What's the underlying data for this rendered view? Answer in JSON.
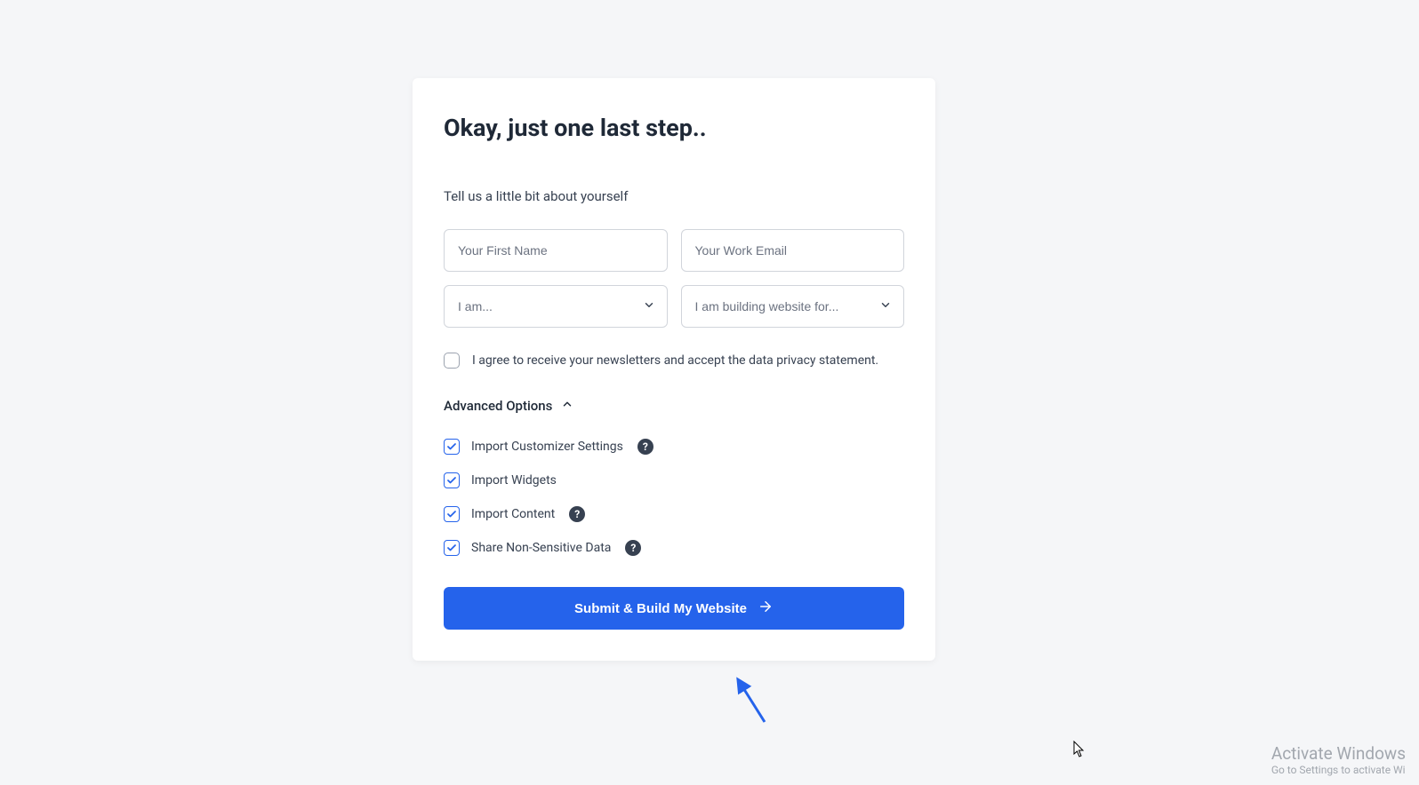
{
  "heading": "Okay, just one last step..",
  "subheading": "Tell us a little bit about yourself",
  "fields": {
    "first_name_placeholder": "Your First Name",
    "email_placeholder": "Your Work Email",
    "role_placeholder": "I am...",
    "building_for_placeholder": "I am building website for..."
  },
  "consent_label": "I agree to receive your newsletters and accept the data privacy statement.",
  "advanced_label": "Advanced Options",
  "options": {
    "import_customizer": "Import Customizer Settings",
    "import_widgets": "Import Widgets",
    "import_content": "Import Content",
    "share_data": "Share Non-Sensitive Data"
  },
  "submit_label": "Submit & Build My Website",
  "watermark": {
    "title": "Activate Windows",
    "sub": "Go to Settings to activate Wi"
  }
}
